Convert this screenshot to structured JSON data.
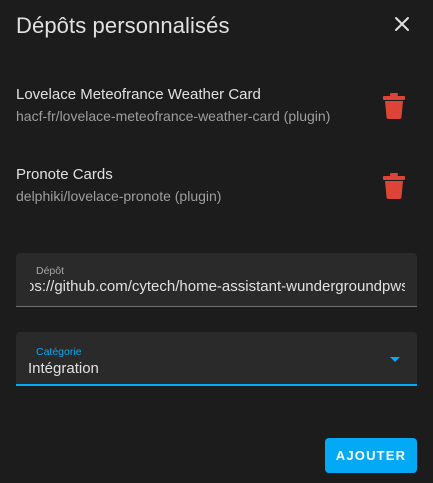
{
  "dialog": {
    "title": "Dépôts personnalisés",
    "close_icon": "close-icon"
  },
  "repositories": [
    {
      "name": "Lovelace Meteofrance Weather Card",
      "path": "hacf-fr/lovelace-meteofrance-weather-card (plugin)",
      "delete_icon": "trash-icon"
    },
    {
      "name": "Pronote Cards",
      "path": "delphiki/lovelace-pronote (plugin)",
      "delete_icon": "trash-icon"
    }
  ],
  "repo_field": {
    "label": "Dépôt",
    "value": "os://github.com/cytech/home-assistant-wundergroundpws"
  },
  "category_field": {
    "label": "Catégorie",
    "value": "Intégration",
    "icon": "chevron-down-icon"
  },
  "actions": {
    "add_label": "AJOUTER"
  },
  "colors": {
    "background": "#1c1c1c",
    "field_background": "#2a2a2a",
    "accent": "#03a9f4",
    "delete": "#db4437",
    "text": "#e1e1e1",
    "secondary_text": "#9e9e9e"
  }
}
